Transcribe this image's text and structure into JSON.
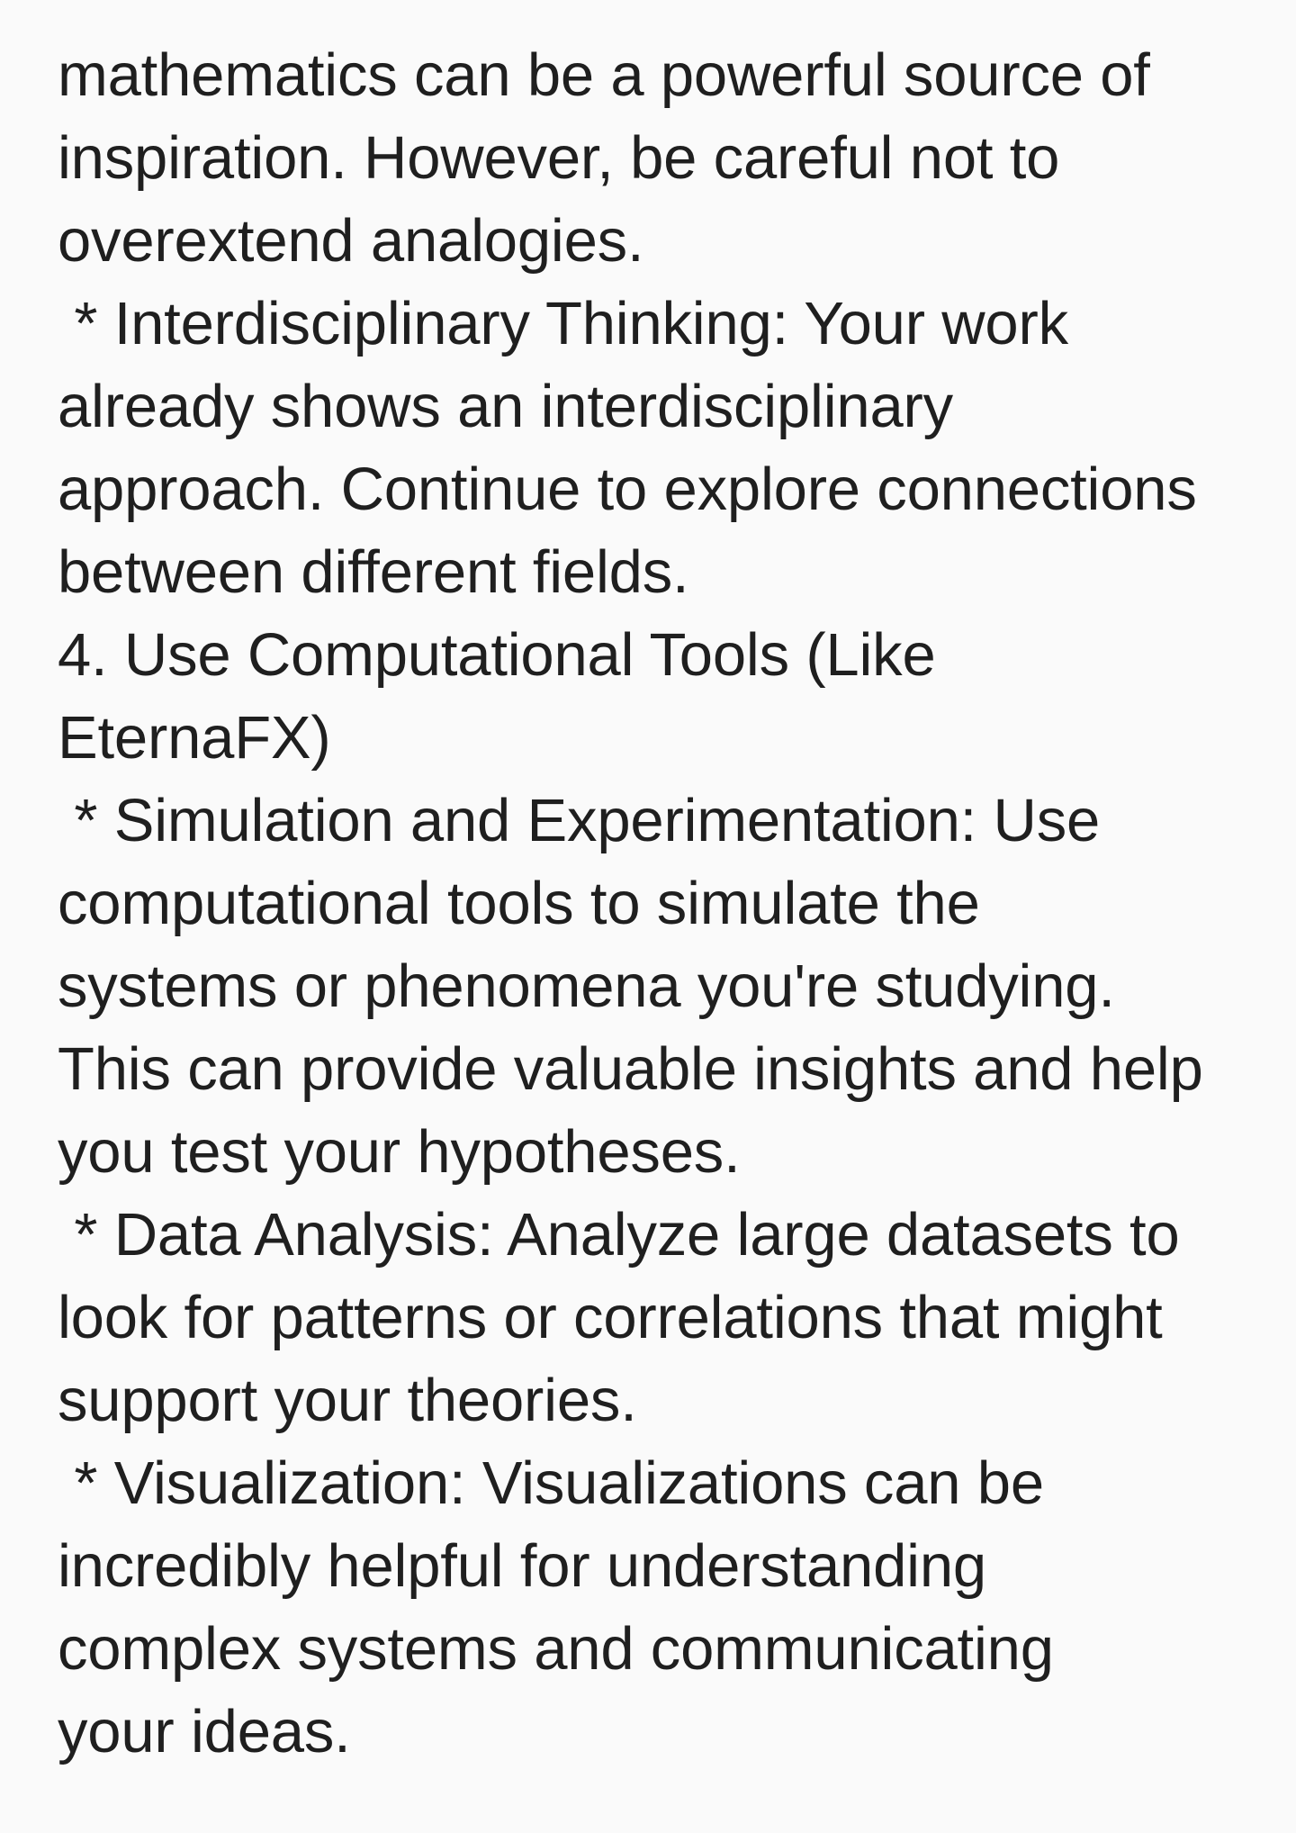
{
  "document": {
    "lines": [
      "mathematics can be a powerful source of",
      "inspiration. However, be careful not to",
      "overextend analogies.",
      " * Interdisciplinary Thinking: Your work",
      "already shows an interdisciplinary",
      "approach. Continue to explore connections",
      "between different fields.",
      "4. Use Computational Tools (Like",
      "EternaFX)",
      " * Simulation and Experimentation: Use",
      "computational tools to simulate the",
      "systems or phenomena you're studying.",
      "This can provide valuable insights and help",
      "you test your hypotheses.",
      " * Data Analysis: Analyze large datasets to",
      "look for patterns or correlations that might",
      "support your theories.",
      " * Visualization: Visualizations can be",
      "incredibly helpful for understanding",
      "complex systems and communicating",
      "your ideas."
    ]
  }
}
